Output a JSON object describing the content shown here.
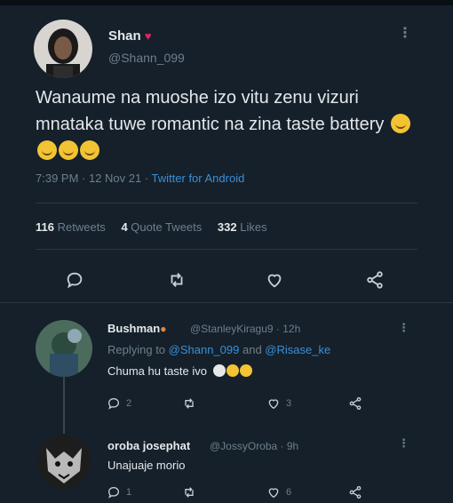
{
  "tweet": {
    "author_name": "Shan",
    "author_handle": "@Shann_099",
    "text": "Wanaume na muoshe izo vitu zenu vizuri mnataka tuwe romantic na zina taste battery",
    "time": "7:39 PM · 12 Nov 21 · ",
    "source": "Twitter for Android",
    "retweets": "116",
    "retweets_label": "Retweets",
    "quotes": "4",
    "quotes_label": "Quote Tweets",
    "likes": "332",
    "likes_label": "Likes",
    "icons": [
      "reply-icon",
      "retweet-icon",
      "like-icon",
      "share-icon"
    ]
  },
  "replies": [
    {
      "name": "Bushman",
      "handle": "@StanleyKiragu9 · 12h",
      "replying_prefix": "Replying to ",
      "mention1": "@Shann_099",
      "and": " and ",
      "mention2": "@Risase_ke",
      "text": "Chuma hu taste ivo",
      "reply_count": "2",
      "like_count": "3"
    },
    {
      "name": "oroba josephat",
      "handle": "@JossyOroba · 9h",
      "text": "Unajuaje morio",
      "reply_count": "1",
      "like_count": "6"
    }
  ],
  "colors": {
    "background": "#15202b",
    "accent": "#3a8fd6",
    "secondary_text": "#6e7f8c",
    "heart_badge": "#e0245e"
  }
}
